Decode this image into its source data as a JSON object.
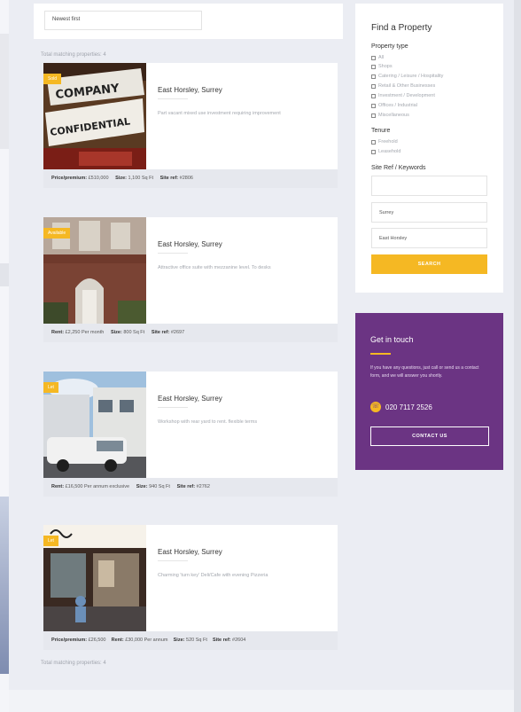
{
  "sort": {
    "value": "Newest first"
  },
  "results": {
    "total_top": "Total matching properties: 4",
    "total_bottom": "Total matching properties: 4"
  },
  "properties": [
    {
      "badge": "Sold",
      "location": "East Horsley, Surrey",
      "description": "Part vacant mixed use investment requiring improvement",
      "meta": [
        {
          "label": "Price/premium:",
          "value": "£510,000"
        },
        {
          "label": "Size:",
          "value": "1,100 Sq Ft"
        },
        {
          "label": "Site ref:",
          "value": "#2806"
        }
      ],
      "image_text": [
        "COMPANY",
        "CONFIDENTIAL"
      ]
    },
    {
      "badge": "Available",
      "location": "East Horsley, Surrey",
      "description": "Attractive office suite with mezzanine level. To desks",
      "meta": [
        {
          "label": "Rent:",
          "value": "£2,250 Per month"
        },
        {
          "label": "Size:",
          "value": "800 Sq Ft"
        },
        {
          "label": "Site ref:",
          "value": "#2697"
        }
      ]
    },
    {
      "badge": "Let",
      "location": "East Horsley, Surrey",
      "description": "Workshop with rear yard to rent. flexible terms",
      "meta": [
        {
          "label": "Rent:",
          "value": "£16,500 Per annum exclusive"
        },
        {
          "label": "Size:",
          "value": "940 Sq Ft"
        },
        {
          "label": "Site ref:",
          "value": "#2762"
        }
      ]
    },
    {
      "badge": "Let",
      "location": "East Horsley, Surrey",
      "description": "Charming 'turn key' Deli/Cafe with evening Pizzeria",
      "meta": [
        {
          "label": "Price/premium:",
          "value": "£26,500"
        },
        {
          "label": "Rent:",
          "value": "£30,000 Per annum"
        },
        {
          "label": "Size:",
          "value": "520 Sq Ft"
        },
        {
          "label": "Site ref:",
          "value": "#2604"
        }
      ]
    }
  ],
  "sidebar": {
    "title": "Find a Property",
    "property_type": {
      "heading": "Property type",
      "options": [
        "All",
        "Shops",
        "Catering / Leisure / Hospitality",
        "Retail & Other Businesses",
        "Investment / Development",
        "Offices / Industrial",
        "Miscellaneous"
      ]
    },
    "tenure": {
      "heading": "Tenure",
      "options": [
        "Freehold",
        "Leasehold"
      ]
    },
    "keywords": {
      "heading": "Site Ref / Keywords",
      "value": "",
      "county": "Surrey",
      "town": "East Horsley"
    },
    "search_label": "SEARCH"
  },
  "contact": {
    "title": "Get in touch",
    "body": "If you have any questions, just call or send us a contact form, and we will answer you shortly.",
    "phone": "020 7117 2526",
    "button_label": "CONTACT US"
  },
  "colors": {
    "accent": "#f5b823",
    "purple": "#6b3483",
    "page_bg": "#ebedf3"
  }
}
